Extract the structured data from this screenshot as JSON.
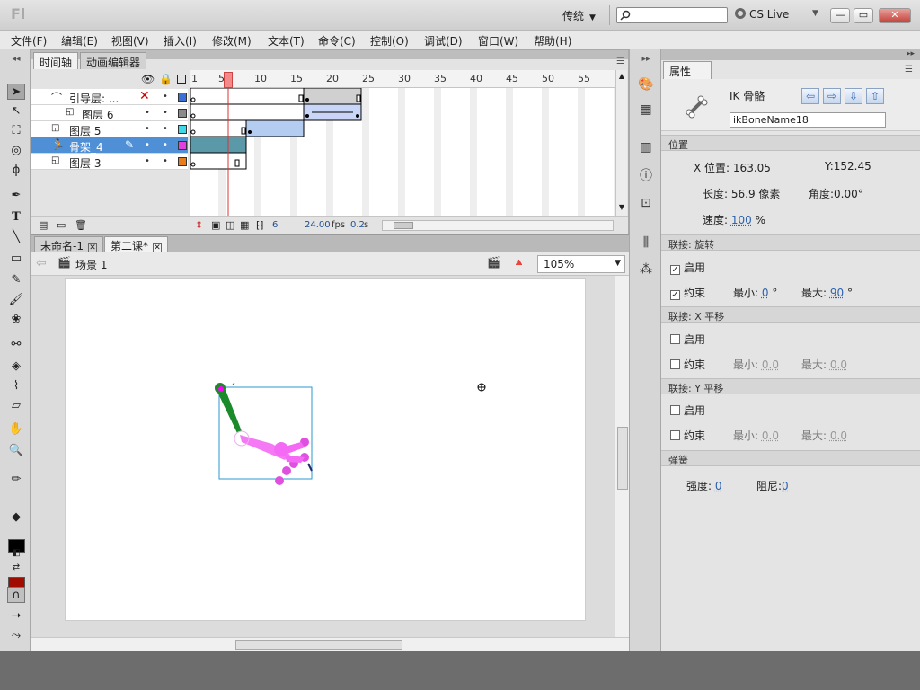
{
  "app": {
    "logo": "Fl",
    "workspace": "传统",
    "cslive": "CS Live",
    "window_controls": {
      "min": "—",
      "max": "▭",
      "close": "✕"
    }
  },
  "menu": [
    "文件(F)",
    "编辑(E)",
    "视图(V)",
    "插入(I)",
    "修改(M)",
    "文本(T)",
    "命令(C)",
    "控制(O)",
    "调试(D)",
    "窗口(W)",
    "帮助(H)"
  ],
  "timeline": {
    "tabs": [
      "时间轴",
      "动画编辑器"
    ],
    "frame_numbers": [
      "1",
      "5",
      "10",
      "15",
      "20",
      "25",
      "30",
      "35",
      "40",
      "45",
      "50",
      "55"
    ],
    "layers": [
      {
        "name": "引导层: ...",
        "color": "#3a6fd6"
      },
      {
        "name": "图层 6",
        "color": "#8a8a8a"
      },
      {
        "name": "图层 5",
        "color": "#40d8e8"
      },
      {
        "name": "骨架_4",
        "color": "#e040e0"
      },
      {
        "name": "图层 3",
        "color": "#e87c1a"
      }
    ],
    "current_frame": "6",
    "fps": "24.00",
    "fps_unit": "fps",
    "elapsed": "0.2",
    "elapsed_unit": "s"
  },
  "documents": {
    "tabs": [
      "未命名-1",
      "第二课*"
    ]
  },
  "editbar": {
    "scene": "场景 1",
    "zoom": "105%"
  },
  "properties": {
    "tab": "属性",
    "type_label": "IK 骨骼",
    "bone_name": "ikBoneName18",
    "sections": {
      "position": "位置",
      "joint_rotation": "联接: 旋转",
      "joint_x": "联接: X 平移",
      "joint_y": "联接: Y 平移",
      "spring": "弹簧"
    },
    "x_pos_label": "X 位置:",
    "x_pos": "163.05",
    "y_pos_label": "Y:",
    "y_pos": "152.45",
    "length_label": "长度:",
    "length": "56.9 像素",
    "angle_label": "角度:",
    "angle": "0.00°",
    "speed_label": "速度:",
    "speed": "100",
    "speed_unit": "%",
    "enable_label": "启用",
    "constrain_label": "约束",
    "min_label": "最小:",
    "max_label": "最大:",
    "rot_min": "0",
    "rot_max": "90",
    "deg": "°",
    "x_min": "0.0",
    "x_max": "0.0",
    "y_min": "0.0",
    "y_max": "0.0",
    "strength_label": "强度:",
    "strength": "0",
    "damping_label": "阻尼:",
    "damping": "0"
  }
}
